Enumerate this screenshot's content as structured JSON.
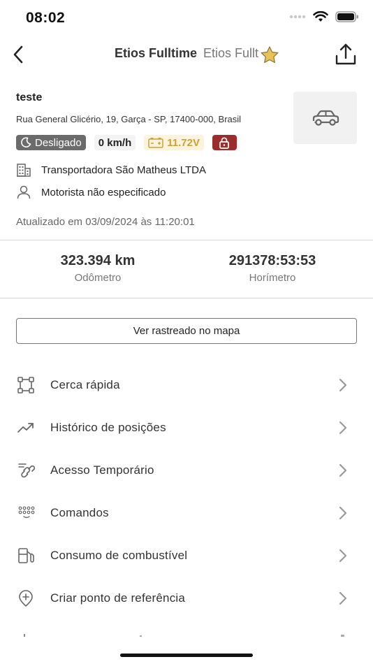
{
  "status_bar": {
    "time": "08:02"
  },
  "header": {
    "title": "Etios Fulltime",
    "subtitle": "Etios Fullt",
    "favorite_color": "#E8C15A"
  },
  "vehicle": {
    "name": "teste",
    "address": "Rua General Glicério, 19, Garça - SP, 17400-000, Brasil",
    "status_badge": "Desligado",
    "speed": "0 km/h",
    "battery": "11.72V",
    "company": "Transportadora São Matheus LTDA",
    "driver": "Motorista não especificado",
    "updated": "Atualizado em 03/09/2024 às 11:20:01",
    "icon": "car-icon"
  },
  "stats": {
    "odometer_value": "323.394 km",
    "odometer_label": "Odômetro",
    "hourmeter_value": "291378:53:53",
    "hourmeter_label": "Horímetro"
  },
  "map_button_label": "Ver rastreado no mapa",
  "menu": [
    {
      "label": "Cerca rápida",
      "icon": "fence-icon"
    },
    {
      "label": "Histórico de posições",
      "icon": "trending-icon"
    },
    {
      "label": "Acesso Temporário",
      "icon": "link-icon"
    },
    {
      "label": "Comandos",
      "icon": "keypad-icon"
    },
    {
      "label": "Consumo de combustível",
      "icon": "fuel-icon"
    },
    {
      "label": "Criar ponto de referência",
      "icon": "map-pin-plus-icon"
    }
  ],
  "colors": {
    "badge_off": "#6B6B6B",
    "battery_text": "#C9A23A",
    "lock_badge": "#9B2D2D"
  }
}
